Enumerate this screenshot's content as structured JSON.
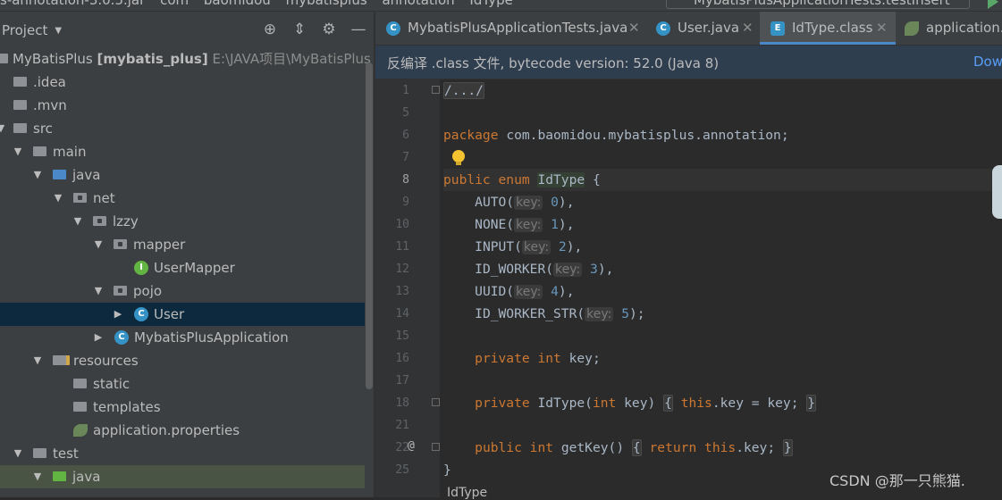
{
  "topbar": {
    "crumbs": [
      "s-annotation-3.0.5.jar",
      "com",
      "baomidou",
      "mybatisplus",
      "annotation",
      "IdType"
    ],
    "run_config": "MybatisPlusApplicationTests.testInsert"
  },
  "project_panel": {
    "title": "Project",
    "tree": [
      {
        "label": "MyBatisPlus",
        "bold": "[mybatis_plus]",
        "path": "E:\\JAVA项目\\MyBatisPlus"
      },
      {
        "label": ".idea"
      },
      {
        "label": ".mvn"
      },
      {
        "label": "src"
      },
      {
        "label": "main"
      },
      {
        "label": "java"
      },
      {
        "label": "net"
      },
      {
        "label": "lzzy"
      },
      {
        "label": "mapper"
      },
      {
        "label": "UserMapper"
      },
      {
        "label": "pojo"
      },
      {
        "label": "User"
      },
      {
        "label": "MybatisPlusApplication"
      },
      {
        "label": "resources"
      },
      {
        "label": "static"
      },
      {
        "label": "templates"
      },
      {
        "label": "application.properties"
      },
      {
        "label": "test"
      },
      {
        "label": "java"
      }
    ]
  },
  "tabs": [
    {
      "label": "MybatisPlusApplicationTests.java"
    },
    {
      "label": "User.java"
    },
    {
      "label": "IdType.class"
    },
    {
      "label": "application."
    }
  ],
  "notice": {
    "text": "反编译 .class 文件, bytecode version: 52.0 (Java 8)",
    "link": "Dow"
  },
  "editor": {
    "line_numbers": [
      "1",
      "5",
      "6",
      "7",
      "8",
      "9",
      "10",
      "11",
      "12",
      "13",
      "14",
      "15",
      "16",
      "17",
      "18",
      "21",
      "22",
      "25"
    ],
    "package_kw": "package",
    "package_name": "com.baomidou.mybatisplus.annotation;",
    "folded_header": "/.../",
    "enum_decl": {
      "kw": "public enum",
      "name": "IdType",
      "brace": "{"
    },
    "constants": [
      {
        "name": "AUTO(",
        "hint": "key:",
        "value": "0",
        "end": "),"
      },
      {
        "name": "NONE(",
        "hint": "key:",
        "value": "1",
        "end": "),"
      },
      {
        "name": "INPUT(",
        "hint": "key:",
        "value": "2",
        "end": "),"
      },
      {
        "name": "ID_WORKER(",
        "hint": "key:",
        "value": "3",
        "end": "),"
      },
      {
        "name": "UUID(",
        "hint": "key:",
        "value": "4",
        "end": "),"
      },
      {
        "name": "ID_WORKER_STR(",
        "hint": "key:",
        "value": "5",
        "end": ");"
      }
    ],
    "field": {
      "kw": "private int",
      "name": "key;"
    },
    "ctor": {
      "kw1": "private",
      "name": "IdType(",
      "kw2": "int",
      "rest": "key)",
      "body_open": "{",
      "kw3": "this",
      "body": ".key = key;",
      "body_close": "}"
    },
    "getter": {
      "kw": "public int",
      "name": "getKey()",
      "body_open": "{",
      "kw2": "return",
      "kw3": "this",
      "body": ".key;",
      "body_close": "}"
    },
    "closing": "}",
    "override_mark": "@",
    "status_breadcrumb": "IdType"
  },
  "watermark": "CSDN @那一只熊猫."
}
